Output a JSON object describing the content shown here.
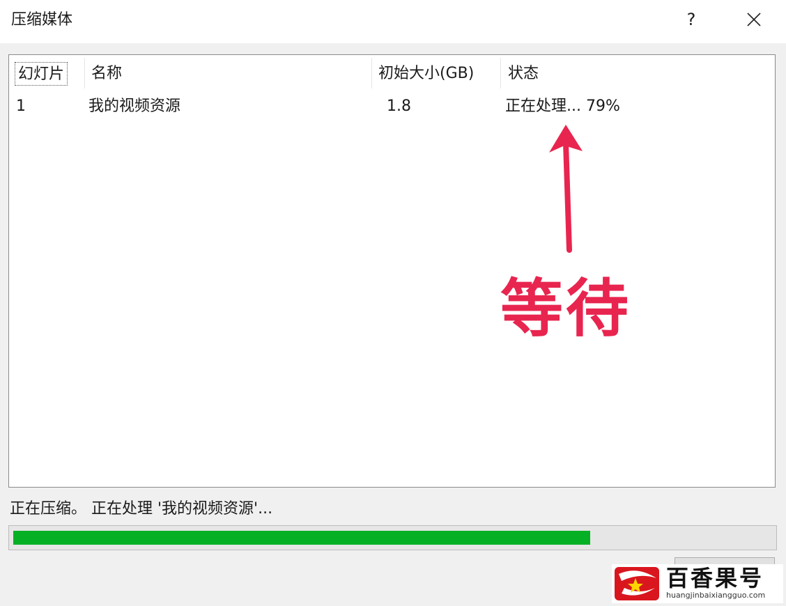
{
  "window": {
    "title": "压缩媒体",
    "help_label": "?"
  },
  "list": {
    "columns": [
      "幻灯片",
      "名称",
      "初始大小(GB)",
      "状态"
    ],
    "rows": [
      {
        "slide": "1",
        "name": "我的视频资源",
        "size": "1.8",
        "status": "正在处理... 79%"
      }
    ]
  },
  "annotation": {
    "text": "等待",
    "color": "#e8254f"
  },
  "footer": {
    "status_text": "正在压缩。 正在处理 '我的视频资源'...",
    "progress_fraction": 0.76,
    "progress_color": "#06b025"
  },
  "watermark": {
    "name": "百香果号",
    "url": "huangjinbaixiangguo.com"
  }
}
